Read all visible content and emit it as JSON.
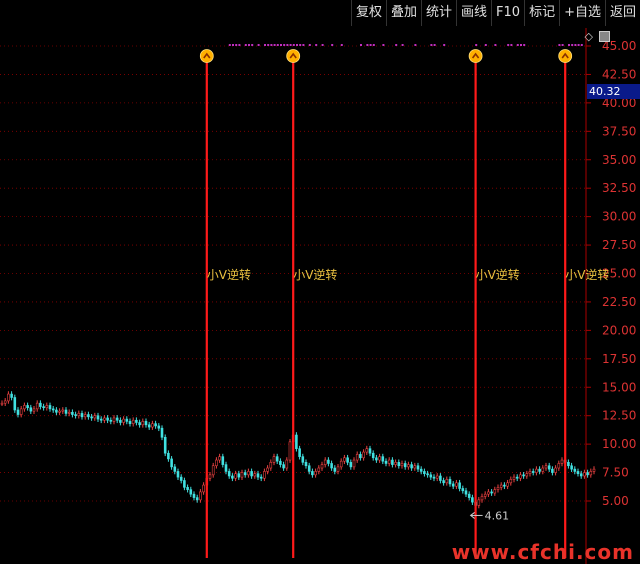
{
  "toolbar": {
    "buttons": [
      "复权",
      "叠加",
      "统计",
      "画线",
      "F10",
      "标记",
      "+自选",
      "返回"
    ]
  },
  "price_tag": "40.32",
  "low_label": "4.61",
  "watermark": "www.cfchi.com",
  "icons": {
    "diamond": "diamond-icon",
    "window": "window-icon"
  },
  "chart_data": {
    "type": "candlestick",
    "y_axis_ticks": [
      "45.00",
      "42.50",
      "40.00",
      "37.50",
      "35.00",
      "32.50",
      "30.00",
      "27.50",
      "25.00",
      "22.50",
      "20.00",
      "17.50",
      "15.00",
      "12.50",
      "10.00",
      "7.50",
      "5.00"
    ],
    "ylim": [
      3.5,
      46.5
    ],
    "signals": [
      {
        "label": "小V逆转",
        "bar": 64
      },
      {
        "label": "小V逆转",
        "bar": 91
      },
      {
        "label": "小V逆转",
        "bar": 148
      },
      {
        "label": "小V逆转",
        "bar": 176
      }
    ],
    "close_series": [
      13.6,
      13.8,
      14.4,
      14.1,
      13.0,
      12.6,
      13.1,
      13.4,
      13.2,
      12.9,
      13.1,
      13.6,
      13.3,
      13.2,
      13.4,
      13.1,
      13.0,
      12.8,
      12.9,
      13.0,
      12.7,
      12.8,
      12.6,
      12.5,
      12.7,
      12.4,
      12.6,
      12.4,
      12.3,
      12.5,
      12.2,
      12.1,
      12.3,
      12.1,
      12.0,
      12.3,
      12.1,
      11.9,
      12.2,
      12.0,
      11.8,
      12.1,
      11.9,
      11.7,
      12.0,
      11.7,
      11.5,
      11.8,
      11.6,
      11.4,
      10.6,
      9.2,
      8.7,
      8.0,
      7.6,
      7.1,
      6.8,
      6.2,
      6.0,
      5.6,
      5.3,
      5.1,
      5.8,
      6.4,
      7.0,
      7.3,
      8.1,
      8.6,
      8.9,
      8.2,
      7.6,
      7.2,
      7.0,
      7.4,
      7.1,
      7.5,
      7.3,
      7.6,
      7.2,
      7.4,
      7.1,
      7.0,
      7.6,
      7.9,
      8.4,
      8.9,
      8.5,
      8.2,
      7.9,
      8.6,
      10.2,
      10.8,
      9.6,
      8.9,
      8.4,
      8.1,
      7.6,
      7.3,
      7.6,
      7.9,
      8.2,
      8.6,
      8.3,
      7.9,
      7.6,
      8.0,
      8.5,
      8.8,
      8.4,
      8.0,
      8.6,
      9.1,
      8.8,
      9.3,
      9.6,
      9.2,
      8.8,
      8.6,
      8.9,
      8.5,
      8.3,
      8.6,
      8.2,
      8.4,
      8.1,
      8.3,
      8.0,
      8.2,
      7.9,
      8.1,
      7.8,
      7.6,
      7.4,
      7.3,
      7.1,
      7.0,
      7.2,
      6.8,
      6.6,
      6.9,
      6.5,
      6.3,
      6.6,
      6.1,
      5.9,
      5.6,
      5.3,
      4.9,
      4.61,
      5.1,
      5.4,
      5.6,
      5.8,
      5.7,
      6.0,
      6.2,
      6.4,
      6.3,
      6.6,
      6.9,
      7.1,
      7.0,
      7.3,
      7.2,
      7.4,
      7.6,
      7.5,
      7.8,
      7.6,
      7.9,
      8.1,
      7.8,
      7.5,
      7.9,
      8.3,
      8.6,
      8.4,
      8.1,
      7.8,
      7.6,
      7.4,
      7.2,
      7.5,
      7.3,
      7.6,
      7.8
    ],
    "dot_bars": [
      44,
      45,
      46,
      47,
      49,
      50,
      51,
      53,
      55,
      56,
      57,
      58,
      59,
      60,
      61,
      62,
      63,
      64,
      65,
      66,
      67,
      69,
      71,
      73,
      76,
      79,
      85,
      87,
      88,
      89,
      92,
      96,
      98,
      102,
      107,
      108,
      111,
      121,
      124,
      127,
      131,
      132,
      134,
      135,
      136,
      147,
      148,
      150,
      151,
      152,
      153,
      154,
      174,
      176,
      178,
      180,
      183,
      185,
      190
    ]
  }
}
